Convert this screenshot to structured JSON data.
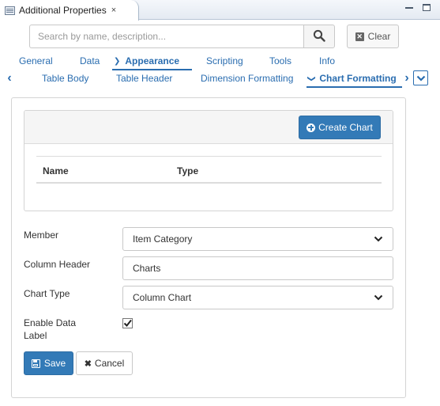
{
  "window": {
    "title": "Additional Properties",
    "close_glyph": "×"
  },
  "search": {
    "placeholder": "Search by name, description...",
    "value": "",
    "clear_label": "Clear"
  },
  "primary_tabs": [
    {
      "label": "General",
      "active": false
    },
    {
      "label": "Data",
      "active": false
    },
    {
      "label": "Appearance",
      "active": true
    },
    {
      "label": "Scripting",
      "active": false
    },
    {
      "label": "Tools",
      "active": false
    },
    {
      "label": "Info",
      "active": false
    }
  ],
  "secondary_tabs": [
    {
      "label": "Table Body",
      "active": false
    },
    {
      "label": "Table Header",
      "active": false
    },
    {
      "label": "Dimension Formatting",
      "active": false
    },
    {
      "label": "Chart Formatting",
      "active": true
    }
  ],
  "charts": {
    "create_label": "Create Chart",
    "columns": [
      "Name",
      "Type"
    ],
    "rows": []
  },
  "form": {
    "member": {
      "label": "Member",
      "value": "Item Category"
    },
    "column_header": {
      "label": "Column Header",
      "value": "Charts"
    },
    "chart_type": {
      "label": "Chart Type",
      "value": "Column Chart"
    },
    "enable_data_label": {
      "label_line1": "Enable Data",
      "label_line2": "Label",
      "checked": true
    }
  },
  "actions": {
    "save_label": "Save",
    "cancel_label": "Cancel"
  },
  "colors": {
    "accent": "#2a6db0",
    "primary_button": "#337ab7"
  },
  "icons": [
    "table-icon",
    "close-icon",
    "minimize-icon",
    "maximize-icon",
    "search-icon",
    "clear-icon",
    "chevron-left-icon",
    "chevron-right-icon",
    "chevron-down-icon",
    "plus-circle-icon",
    "floppy-icon",
    "times-icon",
    "checkmark-icon"
  ]
}
